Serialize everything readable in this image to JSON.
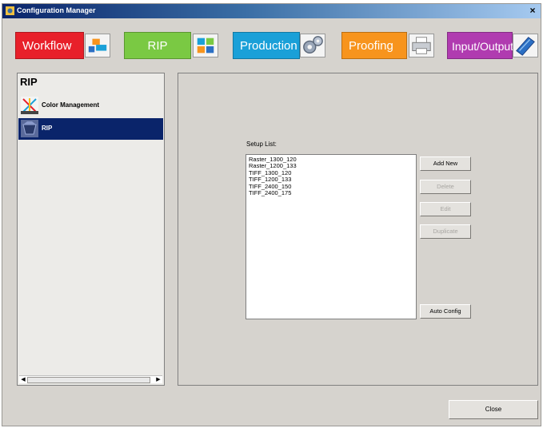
{
  "window": {
    "title": "Configuration Manager"
  },
  "tabs": [
    {
      "label": "Workflow",
      "color": "#e8202a"
    },
    {
      "label": "RIP",
      "color": "#7ac943"
    },
    {
      "label": "Production",
      "color": "#1aa0d8"
    },
    {
      "label": "Proofing",
      "color": "#f7941d"
    },
    {
      "label": "Input/Output",
      "color": "#b03bb0"
    }
  ],
  "sidebar": {
    "heading": "RIP",
    "items": [
      {
        "label": "Color Management",
        "icon": "color-management-icon"
      },
      {
        "label": "RIP",
        "icon": "rip-icon",
        "selected": true
      }
    ]
  },
  "main": {
    "setup_list_label": "Setup List:",
    "setup_list": [
      "Raster_1300_120",
      "Raster_1200_133",
      "TIFF_1300_120",
      "TIFF_1200_133",
      "TIFF_2400_150",
      "TIFF_2400_175"
    ],
    "buttons": {
      "add_new": "Add New",
      "delete": "Delete",
      "edit": "Edit",
      "duplicate": "Duplicate",
      "auto_config": "Auto Config"
    }
  },
  "footer": {
    "close": "Close"
  }
}
